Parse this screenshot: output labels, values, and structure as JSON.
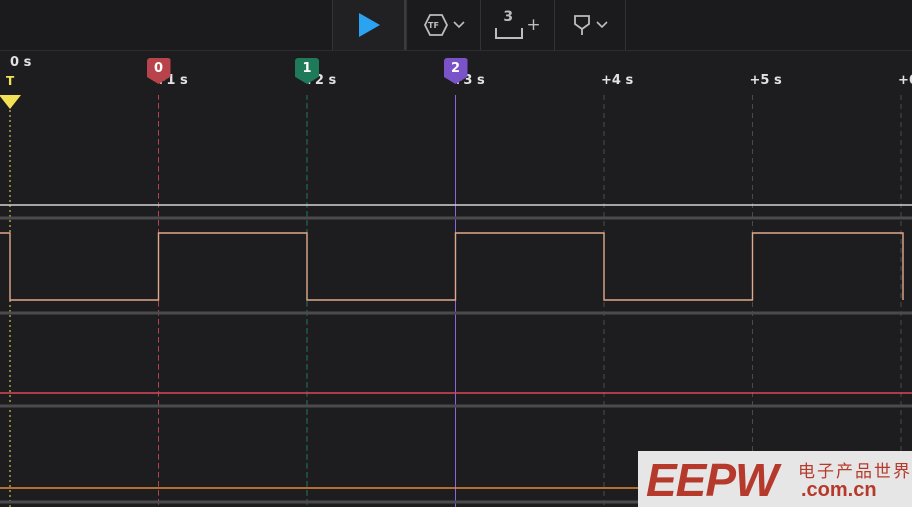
{
  "toolbar": {
    "play_icon": "play-icon",
    "trigger_icon": "trigger-setting-icon",
    "trigger_glyph": "TF",
    "measure_icon": "measurement-icon",
    "measure_count": "3",
    "measure_plus": "+",
    "marker_icon": "marker-pin-icon",
    "colors": {
      "play": "#2aa3f0",
      "icon": "#bdbdbd"
    }
  },
  "ruler": {
    "zero_label": "0 s",
    "trigger_label": "T",
    "ticks": [
      {
        "label": "+1 s",
        "t": 1
      },
      {
        "label": "+2 s",
        "t": 2
      },
      {
        "label": "+3 s",
        "t": 3
      },
      {
        "label": "+4 s",
        "t": 4
      },
      {
        "label": "+5 s",
        "t": 5
      },
      {
        "label": "+6",
        "t": 6
      }
    ],
    "markers": [
      {
        "label": "0",
        "t": 1,
        "color": "#b8434a"
      },
      {
        "label": "1",
        "t": 2,
        "color": "#1f7a5a"
      },
      {
        "label": "2",
        "t": 3,
        "color": "#7a53c9"
      }
    ],
    "trigger_color": "#f2e155"
  },
  "signals": {
    "square_wave": {
      "color": "#e1a88a",
      "period_s": 2,
      "levels": [
        {
          "from": 0,
          "to": 1,
          "state": "low"
        },
        {
          "from": 1,
          "to": 2,
          "state": "high"
        },
        {
          "from": 2,
          "to": 3,
          "state": "low"
        },
        {
          "from": 3,
          "to": 4,
          "state": "high"
        },
        {
          "from": 4,
          "to": 5,
          "state": "low"
        },
        {
          "from": 5,
          "to": 6,
          "state": "high"
        }
      ]
    },
    "red_channel_color": "#d9475a",
    "orange_channel_color": "#e38a3c",
    "white_channel_color": "#d4d4d4"
  },
  "watermark": {
    "logo": "EEPW",
    "chinese": "电子产品世界",
    "domain": ".com.cn",
    "color": "#b63a2c"
  }
}
